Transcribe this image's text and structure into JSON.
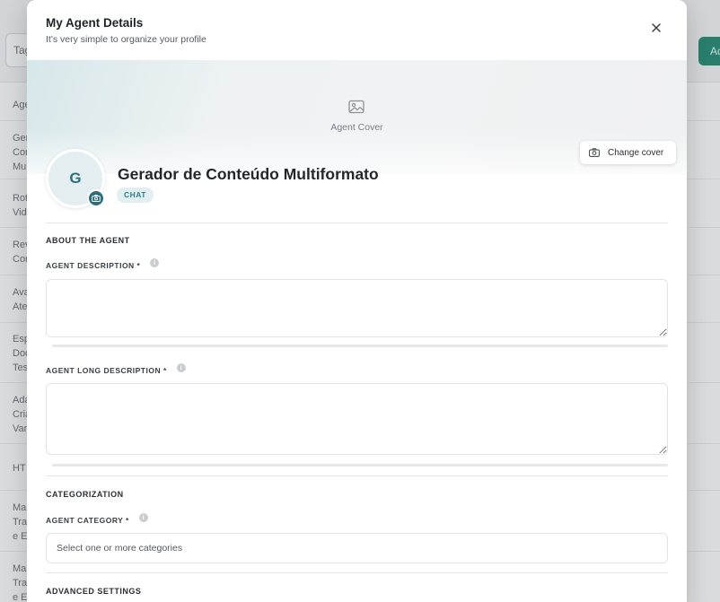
{
  "background": {
    "search_prefix": "Tag",
    "add_button_prefix": "Ad",
    "column_header": "Age",
    "rows": [
      [
        "Ger",
        "Cor",
        "Mul"
      ],
      [
        "Rot",
        "Vid"
      ],
      [
        "Rev",
        "Cor"
      ],
      [
        "Ava",
        "Ate"
      ],
      [
        "Esp",
        "Doc",
        "Tes"
      ],
      [
        "Ada",
        "Cria",
        "Var"
      ],
      [
        "HT"
      ],
      [
        "Ma",
        "Tra",
        "e E"
      ],
      [
        "Ma",
        "Tra",
        "e E"
      ]
    ]
  },
  "modal": {
    "title": "My Agent Details",
    "subtitle": "It's very simple to organize your profile",
    "cover_label": "Agent Cover",
    "change_cover_label": "Change cover",
    "avatar_initial": "G",
    "agent_name": "Gerador de Conteúdo Multiformato",
    "agent_type": "CHAT",
    "about_section": "ABOUT THE AGENT",
    "description_label": "AGENT DESCRIPTION *",
    "description_value": "",
    "long_description_label": "AGENT LONG DESCRIPTION *",
    "long_description_value": "",
    "categorization_section": "CATEGORIZATION",
    "category_label": "AGENT CATEGORY *",
    "category_placeholder": "Select one or more categories",
    "advanced_section": "ADVANCED SETTINGS"
  },
  "colors": {
    "accent": "#2e6e7a",
    "badge_bg": "#e3eef0",
    "add_button": "#2a8a73"
  },
  "icons": [
    "close-icon",
    "image-icon",
    "camera-icon",
    "info-icon"
  ]
}
